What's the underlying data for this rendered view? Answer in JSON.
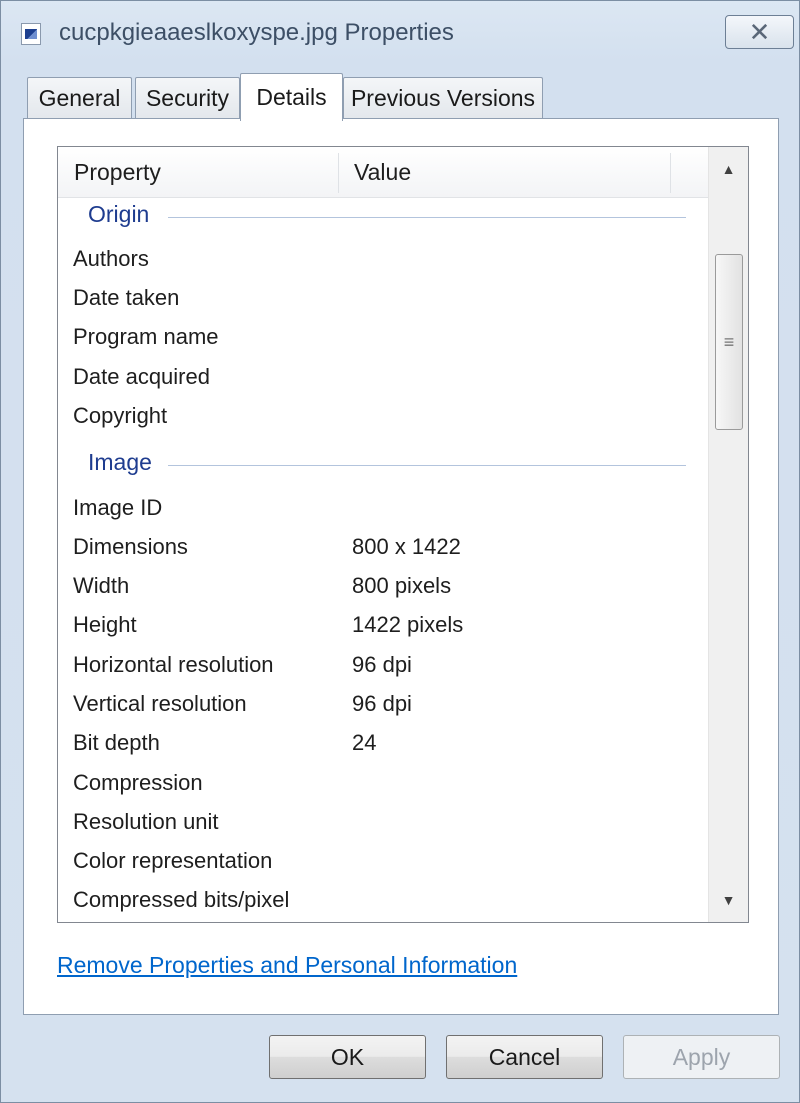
{
  "window": {
    "title": "cucpkgieaaeslkoxyspe.jpg Properties",
    "close_glyph": "✕"
  },
  "tabs": [
    {
      "label": "General",
      "active": false
    },
    {
      "label": "Security",
      "active": false
    },
    {
      "label": "Details",
      "active": true
    },
    {
      "label": "Previous Versions",
      "active": false
    }
  ],
  "list": {
    "columns": {
      "property": "Property",
      "value": "Value"
    },
    "groups": [
      {
        "label": "Origin",
        "rows": [
          {
            "name": "Authors",
            "value": ""
          },
          {
            "name": "Date taken",
            "value": ""
          },
          {
            "name": "Program name",
            "value": ""
          },
          {
            "name": "Date acquired",
            "value": ""
          },
          {
            "name": "Copyright",
            "value": ""
          }
        ]
      },
      {
        "label": "Image",
        "rows": [
          {
            "name": "Image ID",
            "value": ""
          },
          {
            "name": "Dimensions",
            "value": "800 x 1422"
          },
          {
            "name": "Width",
            "value": "800 pixels"
          },
          {
            "name": "Height",
            "value": "1422 pixels"
          },
          {
            "name": "Horizontal resolution",
            "value": "96 dpi"
          },
          {
            "name": "Vertical resolution",
            "value": "96 dpi"
          },
          {
            "name": "Bit depth",
            "value": "24"
          },
          {
            "name": "Compression",
            "value": ""
          },
          {
            "name": "Resolution unit",
            "value": ""
          },
          {
            "name": "Color representation",
            "value": ""
          },
          {
            "name": "Compressed bits/pixel",
            "value": ""
          }
        ]
      }
    ]
  },
  "scrollbar": {
    "up_glyph": "▲",
    "down_glyph": "▼",
    "grip_glyph": "≡"
  },
  "remove_link": "Remove Properties and Personal Information",
  "buttons": {
    "ok": "OK",
    "cancel": "Cancel",
    "apply": "Apply"
  }
}
